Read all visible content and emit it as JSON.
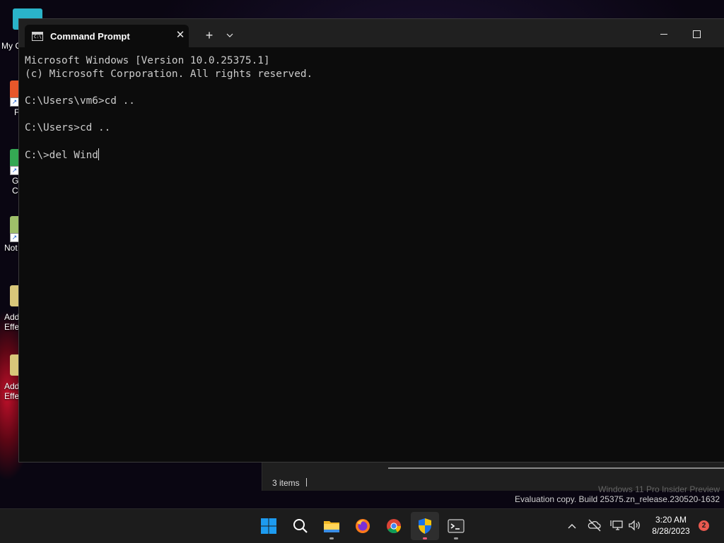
{
  "desktop": {
    "icons": [
      {
        "label": "My C",
        "glyph_color": "#2ab3c9"
      },
      {
        "label": "F",
        "glyph_color": "#e8572a"
      },
      {
        "label": "G\nC",
        "glyph_color": "#34a853"
      },
      {
        "label": "Not",
        "glyph_color": "#9fbf6a"
      },
      {
        "label": "Add\nEffe",
        "glyph_color": "#d9c77a"
      },
      {
        "label": "Add\nEffe",
        "glyph_color": "#d9c77a"
      }
    ]
  },
  "explorer": {
    "status_items": "3 items"
  },
  "watermark": {
    "line1": "Windows 11 Pro Insider Preview",
    "line2": "Evaluation copy. Build 25375.zn_release.230520-1632"
  },
  "terminal": {
    "tab_title": "Command Prompt",
    "tab_close_glyph": "✕",
    "new_tab_glyph": "+",
    "tab_menu_glyph": "⌄",
    "lines": [
      "Microsoft Windows [Version 10.0.25375.1]",
      "(c) Microsoft Corporation. All rights reserved.",
      "",
      "C:\\Users\\vm6>cd ..",
      "",
      "C:\\Users>cd ..",
      "",
      "C:\\>del Wind"
    ]
  },
  "taskbar": {
    "items": [
      {
        "name": "start-button",
        "icon": "windows-logo-icon",
        "active": false,
        "running": false
      },
      {
        "name": "search-button",
        "icon": "search-icon",
        "active": false,
        "running": false
      },
      {
        "name": "file-explorer-button",
        "icon": "folder-icon",
        "active": false,
        "running": true
      },
      {
        "name": "firefox-button",
        "icon": "firefox-icon",
        "active": false,
        "running": false
      },
      {
        "name": "chrome-button",
        "icon": "chrome-icon",
        "active": false,
        "running": false
      },
      {
        "name": "security-button",
        "icon": "shield-icon",
        "active": true,
        "running": true
      },
      {
        "name": "terminal-button",
        "icon": "terminal-icon",
        "active": false,
        "running": true
      }
    ],
    "tray_chevron": "^",
    "clock_time": "3:20 AM",
    "clock_date": "8/28/2023",
    "notification_count": "2"
  }
}
